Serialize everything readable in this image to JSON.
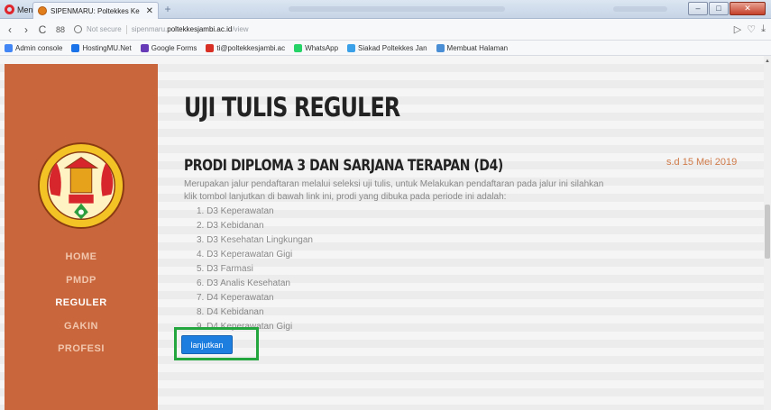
{
  "browser": {
    "menu_label": "Menu",
    "tab_title": "SIPENMARU: Poltekkes Ke",
    "address": {
      "security": "Not secure",
      "pre": "sipenmaru.",
      "domain": "poltekkesjambi.ac.id",
      "path": "/view"
    },
    "bookmarks": [
      {
        "label": "Admin console",
        "icon": "google-icon",
        "color": "#4285f4"
      },
      {
        "label": "HostingMU.Net",
        "icon": "hostingmu-icon",
        "color": "#1a73e8"
      },
      {
        "label": "Google Forms",
        "icon": "forms-icon",
        "color": "#673ab7"
      },
      {
        "label": "ti@poltekkesjambi.ac",
        "icon": "gmail-icon",
        "color": "#d93025"
      },
      {
        "label": "WhatsApp",
        "icon": "whatsapp-icon",
        "color": "#25d366"
      },
      {
        "label": "Siakad Poltekkes Jan",
        "icon": "siakad-icon",
        "color": "#3aa0e8"
      },
      {
        "label": "Membuat Halaman",
        "icon": "wordpress-icon",
        "color": "#4a8fd6"
      }
    ]
  },
  "sidebar": {
    "menu": [
      {
        "label": "HOME",
        "active": false
      },
      {
        "label": "PMDP",
        "active": false
      },
      {
        "label": "REGULER",
        "active": true
      },
      {
        "label": "GAKIN",
        "active": false
      },
      {
        "label": "PROFESI",
        "active": false
      }
    ]
  },
  "main": {
    "title": "UJI TULIS REGULER",
    "subtitle": "PRODI DIPLOMA 3 DAN SARJANA TERAPAN (D4)",
    "date": "s.d 15 Mei 2019",
    "description": "Merupakan jalur pendaftaran melalui seleksi uji tulis, untuk Melakukan pendaftaran pada jalur ini silahkan klik tombol lanjutkan di bawah link ini, prodi yang dibuka pada periode ini adalah:",
    "programs": [
      "1. D3 Keperawatan",
      "2. D3 Kebidanan",
      "3. D3 Kesehatan Lingkungan",
      "4. D3 Keperawatan Gigi",
      "5. D3 Farmasi",
      "6. D3 Analis Kesehatan",
      "7. D4 Keperawatan",
      "8. D4 Kebidanan",
      "9. D4 Keperawatan Gigi"
    ],
    "button_label": "lanjutkan"
  },
  "colors": {
    "sidebar": "#c9663b",
    "button": "#1e7ee0",
    "highlight": "#22a63d",
    "date": "#d07b4a"
  }
}
